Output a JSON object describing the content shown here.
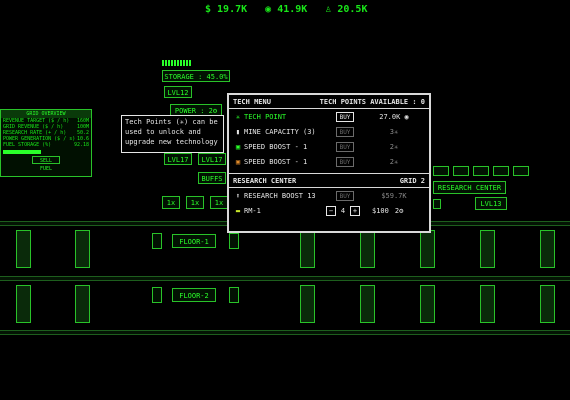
{
  "top": {
    "money": "$ 19.7K",
    "eye": "41.9K",
    "power": "20.5K"
  },
  "tower": {
    "storage": "STORAGE : 45.0%",
    "level1": "LVL12",
    "power": "POWER : 2",
    "level2": "LVL17",
    "level3": "LVL17",
    "buffs": "BUFFS",
    "mult": [
      "1x",
      "1x",
      "1x"
    ]
  },
  "grid_overview": {
    "title": "GRID OVERVIEW",
    "rows": [
      {
        "label": "REVENUE TARGET ($ / h)",
        "value": "160M"
      },
      {
        "label": "GRID REVENUE ($ / h)",
        "value": "100M"
      },
      {
        "label": "RESEARCH RATE (+ / h)",
        "value": "50.2"
      },
      {
        "label": "POWER GENERATION ($ / s)",
        "value": "10.6"
      },
      {
        "label": "FUEL STORAGE (%)",
        "value": "92.18"
      }
    ],
    "button": "SELL FUEL"
  },
  "tooltip": {
    "text": "Tech Points (✳) can be used to unlock and upgrade new technology"
  },
  "tech_menu": {
    "title": "TECH MENU",
    "points_label": "TECH POINTS AVAILABLE : 0",
    "items": [
      {
        "icon": "✳",
        "label": "TECH POINT",
        "buy": "BUY",
        "value": "27.0K",
        "highlight": true
      },
      {
        "icon": "▮",
        "label": "MINE CAPACITY (3)",
        "buy": "BUY",
        "value": "3✳",
        "highlight": false
      },
      {
        "icon": "▣",
        "label": "SPEED BOOST - 1",
        "buy": "BUY",
        "value": "2✳",
        "highlight": false
      },
      {
        "icon": "▣",
        "label": "SPEED BOOST - 1",
        "buy": "BUY",
        "value": "2✳",
        "highlight": false
      }
    ]
  },
  "research": {
    "title": "RESEARCH CENTER",
    "grid": "GRID 2",
    "boost_label": "RESEARCH BOOST 13",
    "boost_buy": "BUY",
    "boost_cost": "$59.7K",
    "rm_label": "RM-1",
    "rm_count": "4",
    "rm_price": "$100",
    "rm_power": "2"
  },
  "right": {
    "research_btn": "RESEARCH CENTER",
    "level": "LVL13"
  },
  "floors": {
    "floor1": "FLOOR-1",
    "floor2": "FLOOR-2"
  }
}
